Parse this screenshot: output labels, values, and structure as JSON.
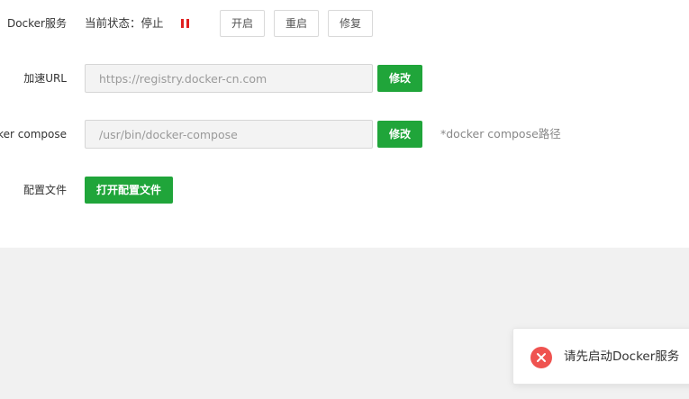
{
  "docker_service": {
    "label": "Docker服务",
    "status_text": "当前状态：停止",
    "status_icon": "pause-icon",
    "status_color": "#e02020",
    "start_label": "开启",
    "restart_label": "重启",
    "repair_label": "修复"
  },
  "mirror": {
    "label": "加速URL",
    "placeholder": "https://registry.docker-cn.com",
    "modify_label": "修改"
  },
  "compose": {
    "label": "Docker compose",
    "placeholder": "/usr/bin/docker-compose",
    "modify_label": "修改",
    "hint": "*docker compose路径"
  },
  "config_file": {
    "label": "配置文件",
    "open_label": "打开配置文件"
  },
  "toast": {
    "icon": "error-icon",
    "message": "请先启动Docker服务"
  },
  "colors": {
    "accent": "#20a53a",
    "error": "#ef5350",
    "background": "#f1f1f1"
  }
}
